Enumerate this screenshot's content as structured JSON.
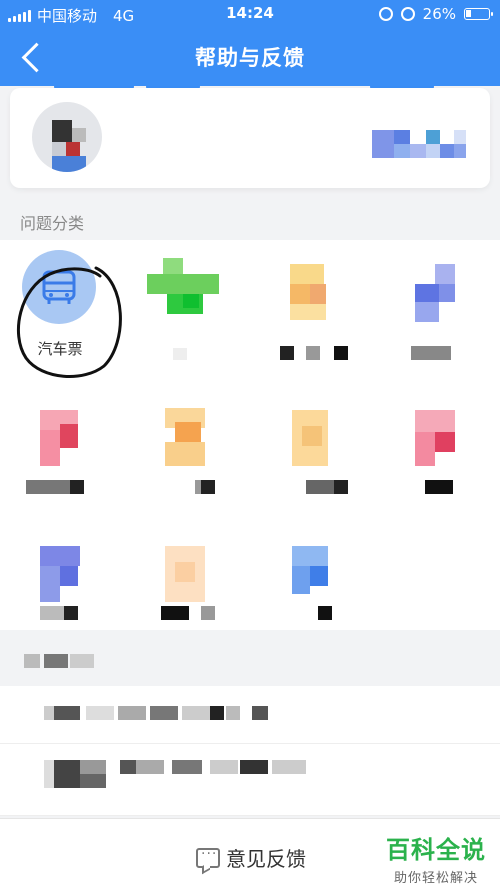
{
  "status_bar": {
    "carrier": "中国移动",
    "network": "4G",
    "time": "14:24",
    "battery": "26%",
    "battery_level": 0.26
  },
  "nav": {
    "title": "帮助与反馈"
  },
  "section": {
    "category_label": "问题分类"
  },
  "categories": [
    {
      "label": "汽车票",
      "icon": "bus-icon"
    }
  ],
  "bottom_bar": {
    "feedback_label": "意见反馈"
  },
  "watermark": {
    "title": "百科全说",
    "subtitle": "助你轻松解决"
  },
  "colors": {
    "nav_blue": "#3a8ef6",
    "bus_circle": "#a9c8f3",
    "watermark_green": "#2bb24c"
  }
}
